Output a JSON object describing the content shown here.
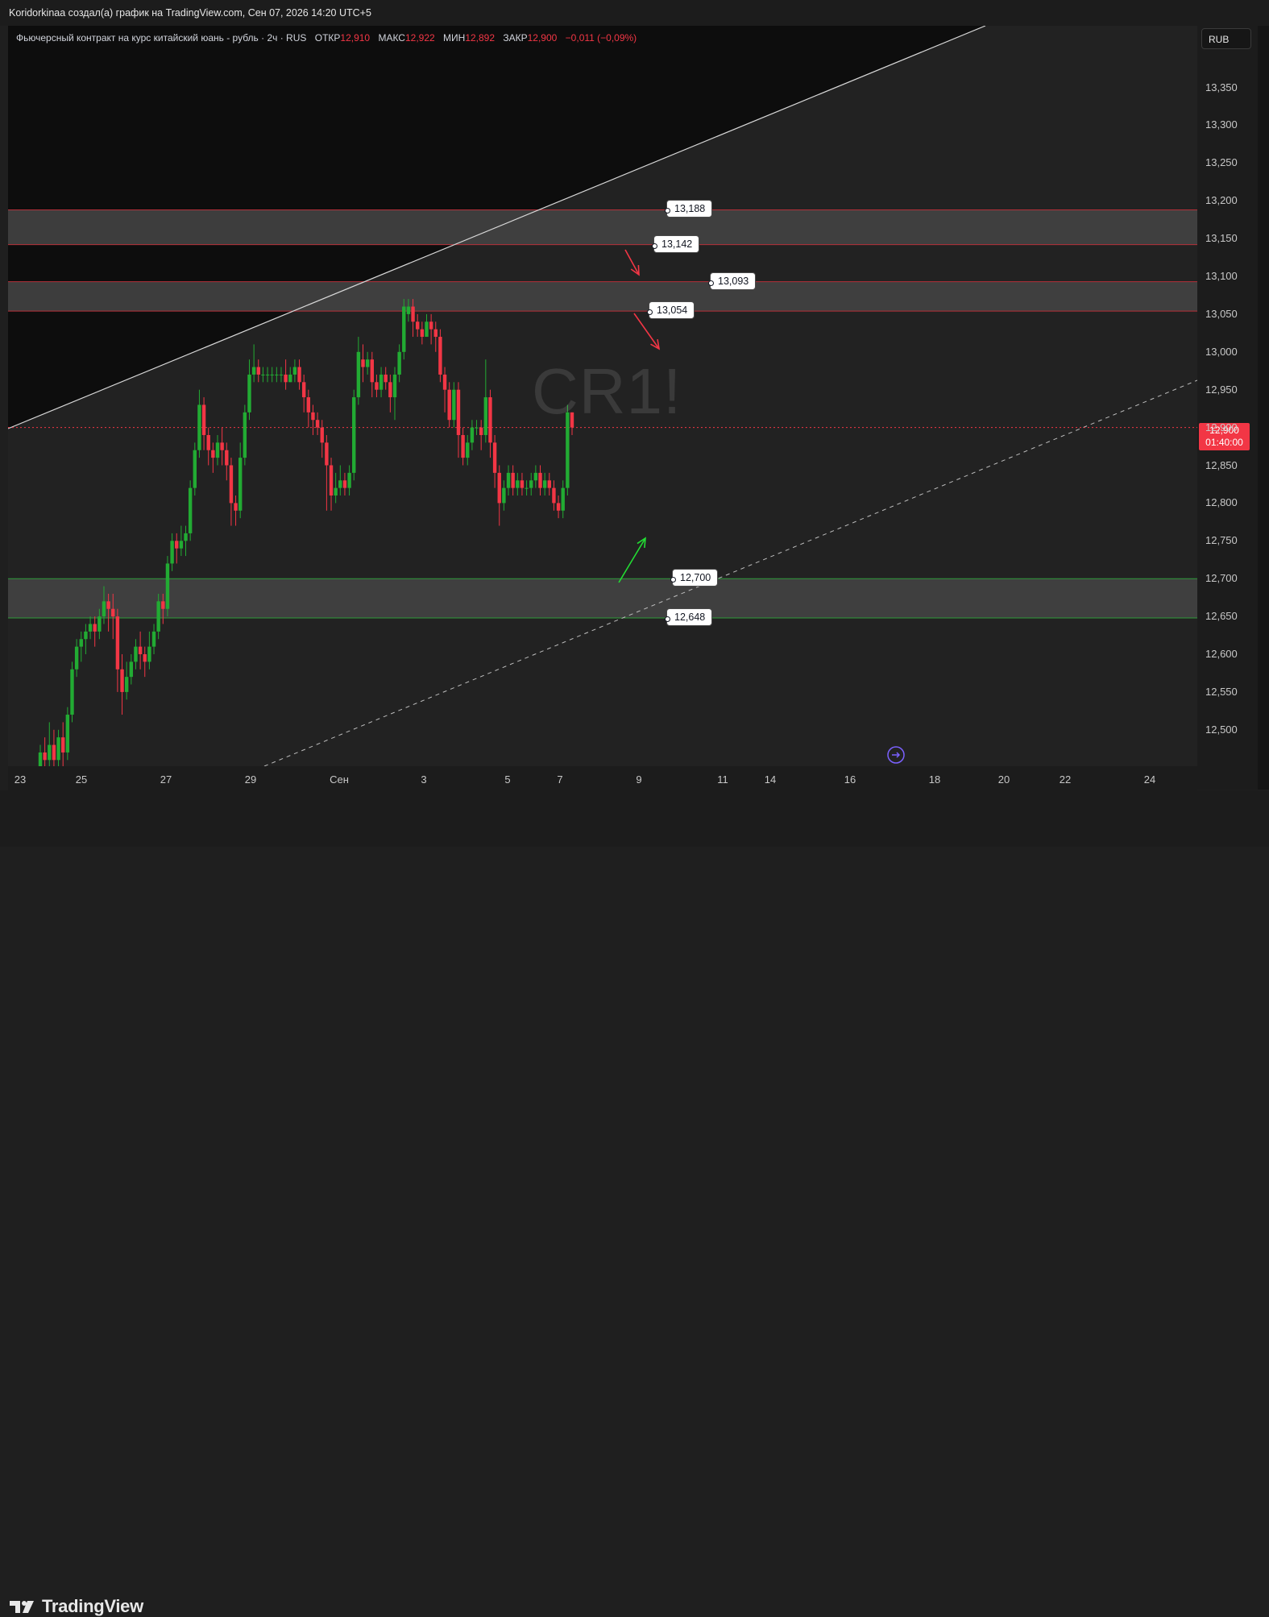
{
  "header": {
    "caption": "Koridorkinaa создал(а) график на TradingView.com, Сен 07, 2026 14:20 UTC+5"
  },
  "legend": {
    "symbol": "Фьючерсный контракт на курс китайский юань - рубль · 2ч · RUS",
    "open_label": "ОТКР",
    "open_value": "12,910",
    "high_label": "МАКС",
    "high_value": "12,922",
    "low_label": "МИН",
    "low_value": "12,892",
    "close_label": "ЗАКР",
    "close_value": "12,900",
    "change": "−0,011 (−0,09%)"
  },
  "currency_button": "RUB",
  "watermark": "CR1!",
  "last_price": {
    "price": "12,900",
    "countdown": "01:40:00"
  },
  "footer": {
    "logo_text": "TradingView"
  },
  "colors": {
    "up": "#22ab33",
    "down": "#f23645",
    "background": "#222222",
    "upper_region": "#0d0d0d",
    "zone": "#434343"
  },
  "chart_data": {
    "type": "candlestick",
    "title": "Фьючерсный контракт на курс китайский юань - рубль",
    "interval": "2ч",
    "y_axis": {
      "ylim": [
        12.456,
        13.42
      ],
      "ticks": [
        "13,350",
        "13,300",
        "13,250",
        "13,200",
        "13,150",
        "13,100",
        "13,050",
        "13,000",
        "12,950",
        "12,900",
        "12,850",
        "12,800",
        "12,750",
        "12,700",
        "12,650",
        "12,600",
        "12,550",
        "12,500"
      ]
    },
    "x_axis": {
      "ticks": [
        "23",
        "25",
        "27",
        "29",
        "Сен",
        "3",
        "5",
        "7",
        "9",
        "11",
        "14",
        "16",
        "18",
        "20",
        "22",
        "24"
      ]
    },
    "zones": [
      {
        "top": 13.188,
        "bottom": 13.142,
        "border": "red"
      },
      {
        "top": 13.093,
        "bottom": 13.054,
        "border": "red"
      },
      {
        "top": 12.7,
        "bottom": 12.648,
        "border": "green"
      }
    ],
    "price_labels": [
      "13,188",
      "13,142",
      "13,093",
      "13,054",
      "12,700",
      "12,648"
    ],
    "current_price": 12.9,
    "arrows": [
      {
        "direction": "down",
        "color": "red"
      },
      {
        "direction": "down",
        "color": "red"
      },
      {
        "direction": "up",
        "color": "green"
      }
    ],
    "candles": [
      [
        12.45,
        12.47,
        12.43,
        12.48
      ],
      [
        12.47,
        12.46,
        12.44,
        12.49
      ],
      [
        12.46,
        12.48,
        12.44,
        12.51
      ],
      [
        12.48,
        12.46,
        12.43,
        12.5
      ],
      [
        12.46,
        12.49,
        12.45,
        12.5
      ],
      [
        12.49,
        12.47,
        12.45,
        12.51
      ],
      [
        12.47,
        12.52,
        12.46,
        12.53
      ],
      [
        12.52,
        12.58,
        12.51,
        12.59
      ],
      [
        12.58,
        12.61,
        12.57,
        12.62
      ],
      [
        12.61,
        12.62,
        12.59,
        12.63
      ],
      [
        12.62,
        12.63,
        12.6,
        12.64
      ],
      [
        12.63,
        12.64,
        12.62,
        12.65
      ],
      [
        12.64,
        12.63,
        12.61,
        12.65
      ],
      [
        12.63,
        12.65,
        12.62,
        12.66
      ],
      [
        12.65,
        12.67,
        12.64,
        12.69
      ],
      [
        12.67,
        12.66,
        12.63,
        12.68
      ],
      [
        12.66,
        12.65,
        12.62,
        12.68
      ],
      [
        12.65,
        12.58,
        12.55,
        12.66
      ],
      [
        12.58,
        12.55,
        12.52,
        12.6
      ],
      [
        12.55,
        12.57,
        12.54,
        12.59
      ],
      [
        12.57,
        12.59,
        12.56,
        12.6
      ],
      [
        12.59,
        12.61,
        12.58,
        12.62
      ],
      [
        12.61,
        12.6,
        12.58,
        12.63
      ],
      [
        12.6,
        12.59,
        12.57,
        12.61
      ],
      [
        12.59,
        12.61,
        12.58,
        12.63
      ],
      [
        12.61,
        12.63,
        12.6,
        12.64
      ],
      [
        12.63,
        12.67,
        12.62,
        12.68
      ],
      [
        12.67,
        12.66,
        12.64,
        12.68
      ],
      [
        12.66,
        12.72,
        12.65,
        12.73
      ],
      [
        12.72,
        12.75,
        12.71,
        12.76
      ],
      [
        12.75,
        12.74,
        12.72,
        12.76
      ],
      [
        12.74,
        12.75,
        12.73,
        12.77
      ],
      [
        12.75,
        12.76,
        12.73,
        12.77
      ],
      [
        12.76,
        12.82,
        12.75,
        12.83
      ],
      [
        12.82,
        12.87,
        12.81,
        12.88
      ],
      [
        12.87,
        12.93,
        12.86,
        12.95
      ],
      [
        12.93,
        12.89,
        12.87,
        12.94
      ],
      [
        12.89,
        12.87,
        12.85,
        12.9
      ],
      [
        12.87,
        12.86,
        12.84,
        12.88
      ],
      [
        12.86,
        12.88,
        12.85,
        12.89
      ],
      [
        12.88,
        12.87,
        12.85,
        12.9
      ],
      [
        12.87,
        12.85,
        12.83,
        12.88
      ],
      [
        12.85,
        12.8,
        12.77,
        12.86
      ],
      [
        12.8,
        12.79,
        12.77,
        12.81
      ],
      [
        12.79,
        12.86,
        12.78,
        12.88
      ],
      [
        12.86,
        12.92,
        12.85,
        12.93
      ],
      [
        12.92,
        12.97,
        12.91,
        12.99
      ],
      [
        12.97,
        12.98,
        12.96,
        13.01
      ],
      [
        12.98,
        12.97,
        12.96,
        12.99
      ],
      [
        12.97,
        12.97,
        12.96,
        12.98
      ],
      [
        12.97,
        12.97,
        12.96,
        12.98
      ],
      [
        12.97,
        12.97,
        12.96,
        12.98
      ],
      [
        12.97,
        12.97,
        12.96,
        12.98
      ],
      [
        12.97,
        12.97,
        12.96,
        12.98
      ],
      [
        12.97,
        12.96,
        12.95,
        12.99
      ],
      [
        12.96,
        12.97,
        12.96,
        12.98
      ],
      [
        12.97,
        12.98,
        12.96,
        12.99
      ],
      [
        12.98,
        12.96,
        12.95,
        12.99
      ],
      [
        12.96,
        12.94,
        12.92,
        12.97
      ],
      [
        12.94,
        12.92,
        12.9,
        12.95
      ],
      [
        12.92,
        12.91,
        12.89,
        12.93
      ],
      [
        12.91,
        12.9,
        12.89,
        12.92
      ],
      [
        12.9,
        12.88,
        12.86,
        12.91
      ],
      [
        12.88,
        12.85,
        12.79,
        12.89
      ],
      [
        12.85,
        12.81,
        12.79,
        12.86
      ],
      [
        12.81,
        12.82,
        12.8,
        12.84
      ],
      [
        12.82,
        12.83,
        12.81,
        12.85
      ],
      [
        12.83,
        12.82,
        12.81,
        12.84
      ],
      [
        12.82,
        12.84,
        12.81,
        12.85
      ],
      [
        12.84,
        12.94,
        12.83,
        12.95
      ],
      [
        12.94,
        13.0,
        12.93,
        13.02
      ],
      [
        12.99,
        12.98,
        12.96,
        13.01
      ],
      [
        12.98,
        12.99,
        12.97,
        13.0
      ],
      [
        12.99,
        12.96,
        12.94,
        13.0
      ],
      [
        12.96,
        12.95,
        12.94,
        12.97
      ],
      [
        12.95,
        12.97,
        12.94,
        12.98
      ],
      [
        12.97,
        12.96,
        12.95,
        12.98
      ],
      [
        12.96,
        12.94,
        12.92,
        12.97
      ],
      [
        12.94,
        12.97,
        12.91,
        12.98
      ],
      [
        12.97,
        13.0,
        12.96,
        13.01
      ],
      [
        13.0,
        13.06,
        12.99,
        13.07
      ],
      [
        13.05,
        13.06,
        13.04,
        13.07
      ],
      [
        13.06,
        13.04,
        13.02,
        13.07
      ],
      [
        13.04,
        13.03,
        13.02,
        13.05
      ],
      [
        13.03,
        13.02,
        13.01,
        13.04
      ],
      [
        13.02,
        13.04,
        13.02,
        13.05
      ],
      [
        13.04,
        13.03,
        13.01,
        13.05
      ],
      [
        13.03,
        13.02,
        13.0,
        13.04
      ],
      [
        13.02,
        12.97,
        12.96,
        13.03
      ],
      [
        12.97,
        12.95,
        12.92,
        12.98
      ],
      [
        12.95,
        12.91,
        12.9,
        12.96
      ],
      [
        12.91,
        12.95,
        12.9,
        12.96
      ],
      [
        12.95,
        12.89,
        12.86,
        12.96
      ],
      [
        12.89,
        12.86,
        12.85,
        12.9
      ],
      [
        12.86,
        12.88,
        12.85,
        12.89
      ],
      [
        12.88,
        12.9,
        12.87,
        12.91
      ],
      [
        12.9,
        12.9,
        12.89,
        12.91
      ],
      [
        12.9,
        12.89,
        12.87,
        12.91
      ],
      [
        12.89,
        12.94,
        12.88,
        12.99
      ],
      [
        12.94,
        12.88,
        12.86,
        12.95
      ],
      [
        12.88,
        12.84,
        12.82,
        12.89
      ],
      [
        12.84,
        12.8,
        12.77,
        12.85
      ],
      [
        12.8,
        12.82,
        12.79,
        12.83
      ],
      [
        12.82,
        12.84,
        12.81,
        12.85
      ],
      [
        12.84,
        12.82,
        12.81,
        12.85
      ],
      [
        12.82,
        12.83,
        12.81,
        12.84
      ],
      [
        12.83,
        12.82,
        12.81,
        12.84
      ],
      [
        12.82,
        12.82,
        12.81,
        12.83
      ],
      [
        12.82,
        12.83,
        12.81,
        12.84
      ],
      [
        12.83,
        12.84,
        12.82,
        12.85
      ],
      [
        12.84,
        12.82,
        12.81,
        12.85
      ],
      [
        12.82,
        12.83,
        12.81,
        12.84
      ],
      [
        12.83,
        12.82,
        12.81,
        12.84
      ],
      [
        12.82,
        12.8,
        12.79,
        12.83
      ],
      [
        12.8,
        12.79,
        12.78,
        12.81
      ],
      [
        12.79,
        12.82,
        12.78,
        12.83
      ],
      [
        12.82,
        12.92,
        12.81,
        12.93
      ],
      [
        12.92,
        12.9,
        12.89,
        12.92
      ]
    ]
  }
}
